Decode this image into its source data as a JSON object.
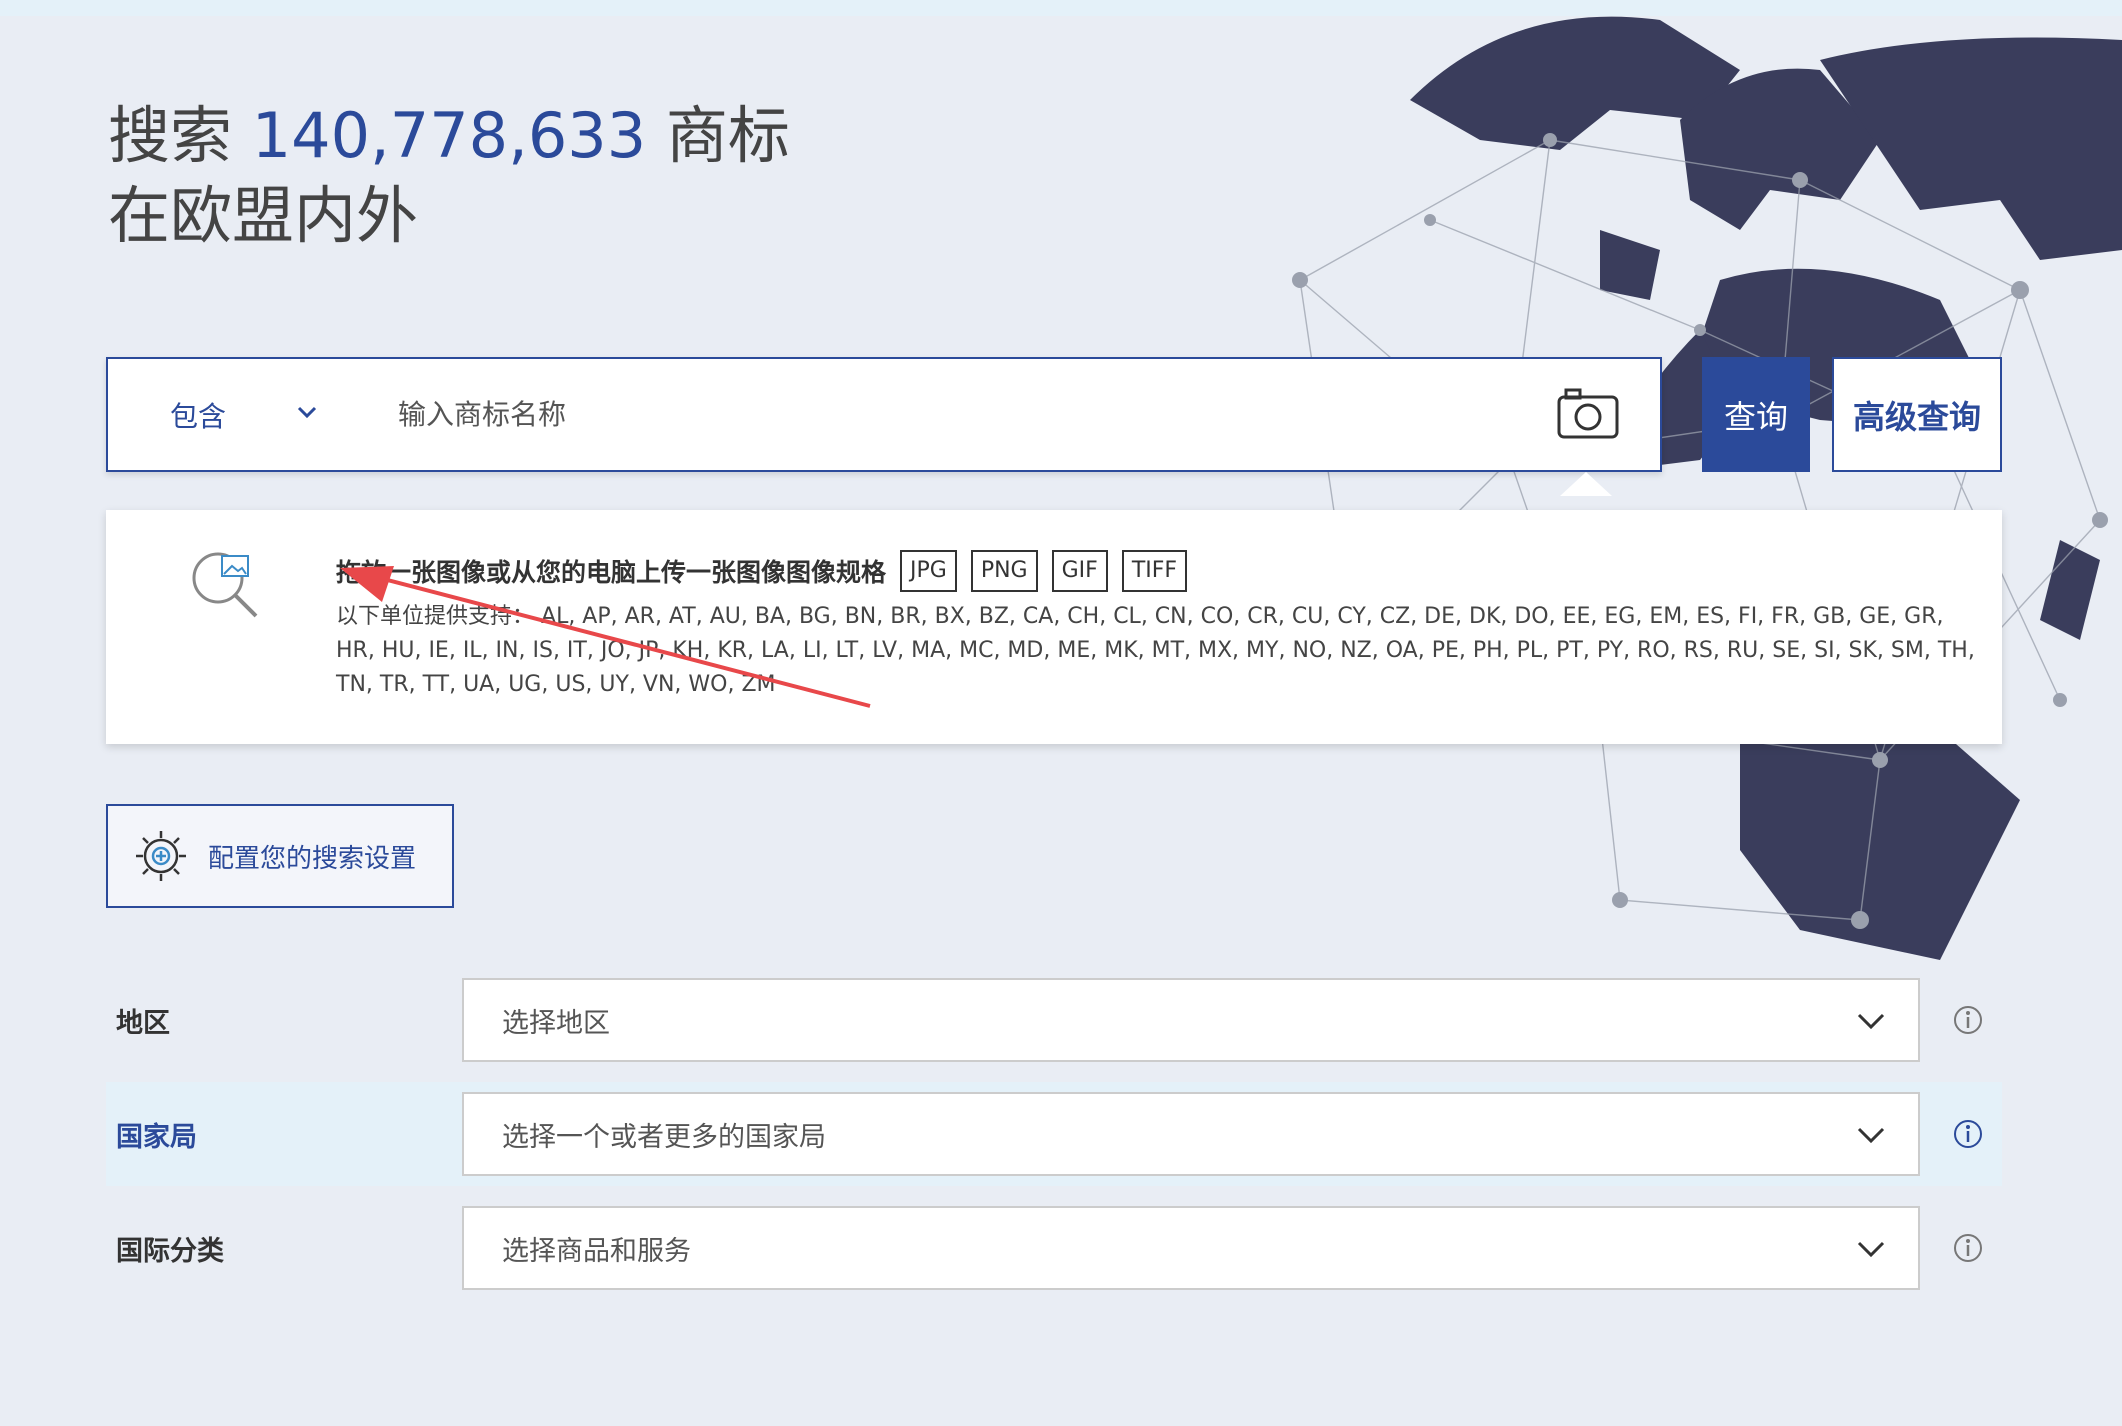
{
  "hero": {
    "prefix": "搜索 ",
    "count": "140,778,633",
    "suffix": " 商标",
    "subline": "在欧盟内外"
  },
  "search": {
    "mode_label": "包含",
    "placeholder": "输入商标名称",
    "camera_icon": "camera-icon",
    "submit_label": "查询",
    "advanced_label": "高级查询"
  },
  "upload": {
    "icon": "image-search-icon",
    "title": "拖放一张图像或从您的电脑上传一张图像图像规格",
    "formats": [
      "JPG",
      "PNG",
      "GIF",
      "TIFF"
    ],
    "offices_prefix": "以下单位提供支持：",
    "offices_list": "AL, AP, AR, AT, AU, BA, BG, BN, BR, BX, BZ, CA, CH, CL, CN, CO, CR, CU, CY, CZ, DE, DK, DO, EE, EG, EM, ES, FI, FR, GB, GE, GR, HR, HU, IE, IL, IN, IS, IT, JO, JP, KH, KR, LA, LI, LT, LV, MA, MC, MD, ME, MK, MT, MX, MY, NO, NZ, OA, PE, PH, PL, PT, PY, RO, RS, RU, SE, SI, SK, SM, TH, TN, TR, TT, UA, UG, US, UY, VN, WO, ZM"
  },
  "config": {
    "label": "配置您的搜索设置",
    "icon": "gear-plus-icon"
  },
  "filters": [
    {
      "label": "地区",
      "placeholder": "选择地区",
      "highlighted": false
    },
    {
      "label": "国家局",
      "placeholder": "选择一个或者更多的国家局",
      "highlighted": true
    },
    {
      "label": "国际分类",
      "placeholder": "选择商品和服务",
      "highlighted": false
    }
  ],
  "colors": {
    "brand_blue": "#2b4a9a",
    "page_bg": "#e9edf4",
    "highlight_row": "#e4f1f9",
    "annotation_red": "#e8484a",
    "globe_land": "#3a3d5c"
  }
}
